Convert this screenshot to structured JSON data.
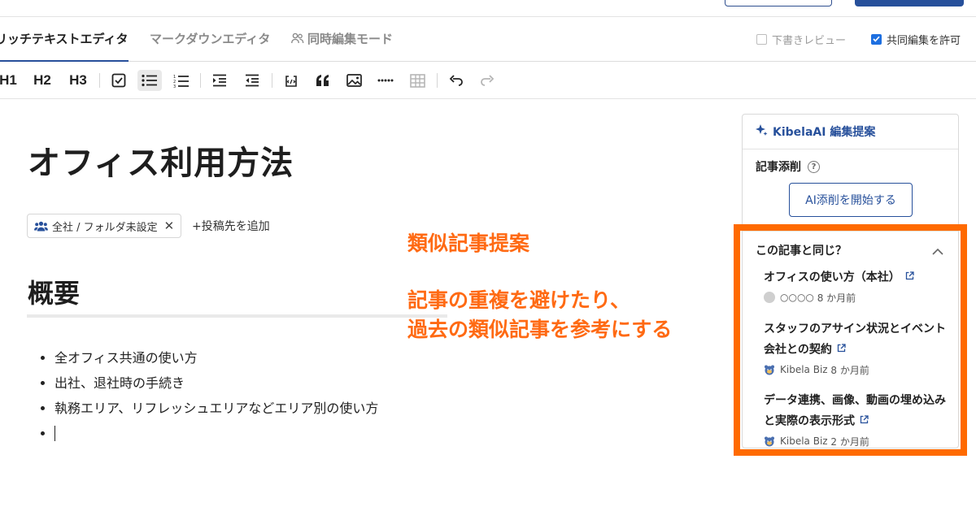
{
  "tabs": {
    "rich_text": "リッチテキストエディタ",
    "markdown": "マークダウンエディタ",
    "coedit": "同時編集モード"
  },
  "options": {
    "draft_review": "下書きレビュー",
    "allow_coedit": "共同編集を許可"
  },
  "toolbar": {
    "h1": "H1",
    "h2": "H2",
    "h3": "H3"
  },
  "document": {
    "title": "オフィス利用方法",
    "destination_chip": "全社 / フォルダ未設定",
    "add_destination": "+投稿先を追加",
    "heading": "概要",
    "bullets": [
      "全オフィス共通の使い方",
      "出社、退社時の手続き",
      "執務エリア、リフレッシュエリアなどエリア別の使い方"
    ]
  },
  "annotation": {
    "title": "類似記事提案",
    "line1": "記事の重複を避けたり、",
    "line2": "過去の類似記事を参考にする"
  },
  "ai_panel": {
    "header": "KibelaAI 編集提案",
    "correction_label": "記事添削",
    "help": "?",
    "start_button": "AI添削を開始する",
    "similar_title": "この記事と同じ？",
    "items": [
      {
        "title": "オフィスの使い方（本社）",
        "author": "○○○○",
        "time": "8 か月前"
      },
      {
        "title": "スタッフのアサイン状況とイベント会社との契約",
        "author": "Kibela Biz",
        "time": "8 か月前"
      },
      {
        "title": "データ連携、画像、動画の埋め込みと実際の表示形式",
        "author": "Kibela Biz",
        "time": "2 か月前"
      }
    ]
  },
  "colors": {
    "accent": "#27509b",
    "annotation": "#ff6a13",
    "checkbox": "#1d6fe0"
  }
}
